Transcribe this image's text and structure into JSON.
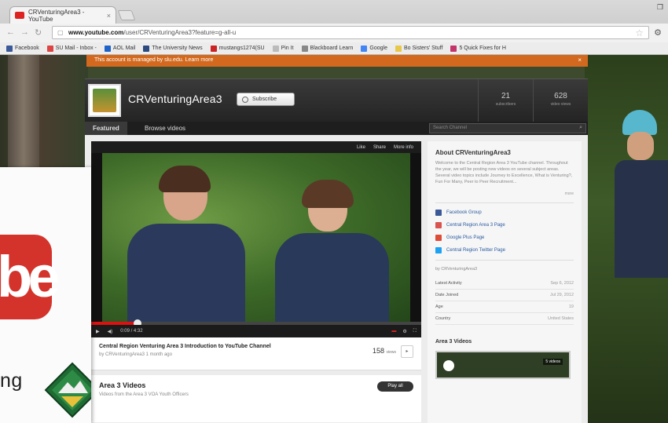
{
  "browser": {
    "tab_title": "CRVenturingArea3 - YouTube",
    "tab_close": "×",
    "url_domain": "www.youtube.com",
    "url_path": "/user/CRVenturingArea3?feature=g-all-u",
    "bookmarks": [
      {
        "label": "Facebook",
        "color": "#3b5998"
      },
      {
        "label": "SU Mail - Inbox -",
        "color": "#d44"
      },
      {
        "label": "AOL Mail",
        "color": "#1e64c8"
      },
      {
        "label": "The University News",
        "color": "#2a4a80"
      },
      {
        "label": "mustangs1274(SU",
        "color": "#c22"
      },
      {
        "label": "Pin It",
        "color": "#bbb"
      },
      {
        "label": "Blackboard Learn",
        "color": "#888"
      },
      {
        "label": "Google",
        "color": "#4285f4"
      },
      {
        "label": "Bo Sisters' Stuff",
        "color": "#e8c84a"
      },
      {
        "label": "5 Quick Fixes for H",
        "color": "#c3346b"
      }
    ]
  },
  "banner": {
    "text": "This account is managed by slu.edu. Learn more",
    "close": "×"
  },
  "channel": {
    "name": "CRVenturingArea3",
    "subscribe_label": "Subscribe",
    "stats": [
      {
        "num": "21",
        "label": "subscribers"
      },
      {
        "num": "628",
        "label": "video views"
      }
    ],
    "tabs": [
      "Featured",
      "Browse videos"
    ],
    "search_placeholder": "Search Channel"
  },
  "player": {
    "top_actions": [
      "Like",
      "Share",
      "More info"
    ],
    "progress": 0.14,
    "time": "0:09 / 4:32"
  },
  "video": {
    "title": "Central Region Venturing Area 3 Introduction to YouTube Channel",
    "by": "by CRVenturingArea3  1 month ago",
    "views": "158",
    "views_label": "views"
  },
  "section": {
    "title": "Area 3 Videos",
    "subtitle": "Videos from the Area 3 VOA Youth Officers",
    "play_all": "Play all"
  },
  "sidebar": {
    "about_title": "About CRVenturingArea3",
    "about_desc": "Welcome to the Central Region Area 3 YouTube channel. Throughout the year, we will be posting new videos on several subject areas. Several video topics include Journey to Excellence, What is Venturing?, Fun For Many, Peer to Peer Recruitment...",
    "more": "more",
    "links": [
      {
        "label": "Facebook Group",
        "color": "#3b5998"
      },
      {
        "label": "Central Region Area 3 Page",
        "color": "#d9534f"
      },
      {
        "label": "Google Plus Page",
        "color": "#dd4b39"
      },
      {
        "label": "Central Region Twitter Page",
        "color": "#1da1f2"
      }
    ],
    "byline": "by CRVenturingArea3",
    "meta": [
      {
        "k": "Latest Activity",
        "v": "Sep 6, 2012"
      },
      {
        "k": "Date Joined",
        "v": "Jul 29, 2012"
      },
      {
        "k": "Age",
        "v": "19"
      },
      {
        "k": "Country",
        "v": "United States"
      }
    ],
    "videos_title": "Area 3 Videos",
    "thumb_count": "5 videos"
  },
  "overlay": {
    "word": "ng"
  }
}
